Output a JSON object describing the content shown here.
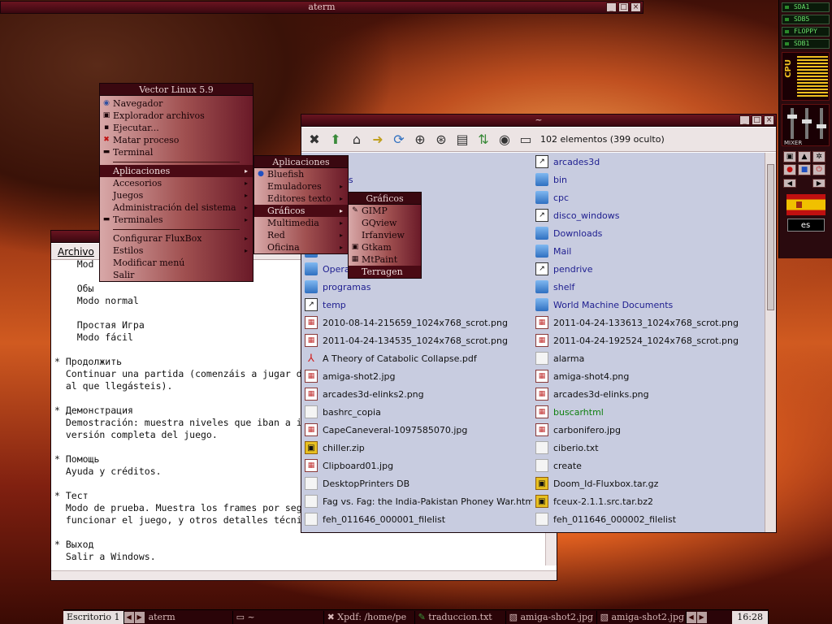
{
  "aterm": {
    "title": "aterm"
  },
  "editor": {
    "menu_archivo": "Archivo",
    "lines": [
      "    Mod",
      "",
      "    Обы",
      "    Modo normal",
      "",
      "    Простая Игра",
      "    Modo fácil",
      "",
      "* Продолжить",
      "  Continuar una partida (comenzáis a jugar d",
      "  al que llegásteis).",
      "",
      "* Демонстрация",
      "  Demostración: muestra niveles que iban a i",
      "  versión completa del juego.",
      "",
      "* Помощь",
      "  Ayuda y créditos.",
      "",
      "* Тест",
      "  Modo de prueba. Muestra los frames por seg",
      "  funcionar el juego, y otros detalles técni",
      "",
      "* Выход",
      "  Salir a Windows."
    ]
  },
  "file_manager": {
    "title": "~",
    "count": "102 elementos (399 oculto)",
    "col1": [
      {
        "name": "a",
        "icon": "folder",
        "color": "blue"
      },
      {
        "name": "rounds",
        "icon": "folder",
        "color": "blue"
      },
      {
        "name": "",
        "icon": "folder",
        "color": "blue"
      },
      {
        "name": "",
        "icon": "folder",
        "color": "blue"
      },
      {
        "name": "",
        "icon": "folder",
        "color": "blue"
      },
      {
        "name": "",
        "icon": "folder",
        "color": "blue"
      },
      {
        "name": "Opera",
        "icon": "folder",
        "color": "blue"
      },
      {
        "name": "programas",
        "icon": "folder",
        "color": "blue"
      },
      {
        "name": "temp",
        "icon": "link",
        "color": "blue"
      },
      {
        "name": "2010-08-14-215659_1024x768_scrot.png",
        "icon": "img",
        "color": "black"
      },
      {
        "name": "2011-04-24-134535_1024x768_scrot.png",
        "icon": "img",
        "color": "black"
      },
      {
        "name": "A Theory of Catabolic Collapse.pdf",
        "icon": "pdf",
        "color": "black"
      },
      {
        "name": "amiga-shot2.jpg",
        "icon": "img",
        "color": "black"
      },
      {
        "name": "arcades3d-elinks2.png",
        "icon": "img",
        "color": "black"
      },
      {
        "name": "bashrc_copia",
        "icon": "doc",
        "color": "black"
      },
      {
        "name": "CapeCaneveral-1097585070.jpg",
        "icon": "img",
        "color": "black"
      },
      {
        "name": "chiller.zip",
        "icon": "zip",
        "color": "black"
      },
      {
        "name": "Clipboard01.jpg",
        "icon": "img",
        "color": "black"
      },
      {
        "name": "DesktopPrinters DB",
        "icon": "doc",
        "color": "black"
      },
      {
        "name": "Fag vs. Fag: the India-Pakistan Phoney War.htm",
        "icon": "doc",
        "color": "black"
      },
      {
        "name": "feh_011646_000001_filelist",
        "icon": "doc",
        "color": "black"
      }
    ],
    "col2": [
      {
        "name": "arcades3d",
        "icon": "link",
        "color": "blue"
      },
      {
        "name": "bin",
        "icon": "folder",
        "color": "blue"
      },
      {
        "name": "cpc",
        "icon": "folder",
        "color": "blue"
      },
      {
        "name": "disco_windows",
        "icon": "link",
        "color": "blue"
      },
      {
        "name": "Downloads",
        "icon": "folder",
        "color": "blue"
      },
      {
        "name": "Mail",
        "icon": "folder",
        "color": "blue"
      },
      {
        "name": "pendrive",
        "icon": "link",
        "color": "blue"
      },
      {
        "name": "shelf",
        "icon": "folder",
        "color": "blue"
      },
      {
        "name": "World Machine Documents",
        "icon": "folder",
        "color": "blue"
      },
      {
        "name": "2011-04-24-133613_1024x768_scrot.png",
        "icon": "img",
        "color": "black"
      },
      {
        "name": "2011-04-24-192524_1024x768_scrot.png",
        "icon": "img",
        "color": "black"
      },
      {
        "name": "alarma",
        "icon": "doc",
        "color": "black"
      },
      {
        "name": "amiga-shot4.png",
        "icon": "img",
        "color": "black"
      },
      {
        "name": "arcades3d-elinks.png",
        "icon": "img",
        "color": "black"
      },
      {
        "name": "buscarhtml",
        "icon": "img",
        "color": "green"
      },
      {
        "name": "carbonifero.jpg",
        "icon": "img",
        "color": "black"
      },
      {
        "name": "ciberio.txt",
        "icon": "doc",
        "color": "black"
      },
      {
        "name": "create",
        "icon": "doc",
        "color": "black"
      },
      {
        "name": "Doom_Id-Fluxbox.tar.gz",
        "icon": "zip",
        "color": "black"
      },
      {
        "name": "fceux-2.1.1.src.tar.bz2",
        "icon": "zip",
        "color": "black"
      },
      {
        "name": "feh_011646_000002_filelist",
        "icon": "doc",
        "color": "black"
      }
    ]
  },
  "root_menu": {
    "title": "Vector Linux 5.9",
    "items": [
      "Navegador",
      "Explorador archivos",
      "Ejecutar...",
      "Matar proceso",
      "Terminal"
    ],
    "items2": [
      "Aplicaciones",
      "Accesorios",
      "Juegos",
      "Administración del sistema",
      "Terminales"
    ],
    "items3": [
      "Configurar FluxBox",
      "Estilos",
      "Modificar menú",
      "Salir"
    ]
  },
  "apps_menu": {
    "title": "Aplicaciones",
    "items": [
      "Bluefish",
      "Emuladores",
      "Editores texto",
      "Gráficos",
      "Multimedia",
      "Red",
      "Oficina"
    ]
  },
  "graficos_menu": {
    "title": "Gráficos",
    "items": [
      "GIMP",
      "GQview",
      "Irfanview",
      "Gtkam",
      "MtPaint",
      "Terragen"
    ]
  },
  "dock": {
    "leds": [
      "SDA1",
      "SDB5",
      "FLOPPY",
      "SDB1"
    ],
    "cpu_label": "CPU",
    "mixer_label": "MIXER",
    "lang": "es"
  },
  "taskbar": {
    "workspace": "Escritorio 1",
    "tasks": [
      "aterm",
      "~",
      "Xpdf: /home/pe",
      "traduccion.txt",
      "amiga-shot2.jpg",
      "amiga-shot2.jpg"
    ],
    "clock": "16:28"
  }
}
